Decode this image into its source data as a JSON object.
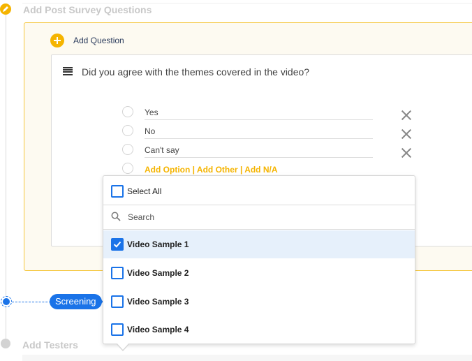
{
  "steps": {
    "post_survey_title": "Add Post Survey Questions",
    "screening_label": "Screening",
    "add_testers_title": "Add Testers"
  },
  "survey": {
    "add_question_label": "Add Question",
    "question_text": "Did you agree with the themes covered in the video?",
    "options": [
      {
        "label": "Yes"
      },
      {
        "label": "No"
      },
      {
        "label": "Can't say"
      }
    ],
    "add_option_label": "Add Option",
    "add_other_label": "Add Other",
    "add_na_label": "Add N/A",
    "separator": "|"
  },
  "dropdown": {
    "select_all_label": "Select All",
    "search_placeholder": "Search",
    "items": [
      {
        "label": "Video Sample 1",
        "checked": true
      },
      {
        "label": "Video Sample 2",
        "checked": false
      },
      {
        "label": "Video Sample 3",
        "checked": false
      },
      {
        "label": "Video Sample 4",
        "checked": false
      }
    ]
  },
  "colors": {
    "accent_yellow": "#f5b400",
    "primary_blue": "#1a73e8",
    "selected_row": "#e6f0fb"
  }
}
